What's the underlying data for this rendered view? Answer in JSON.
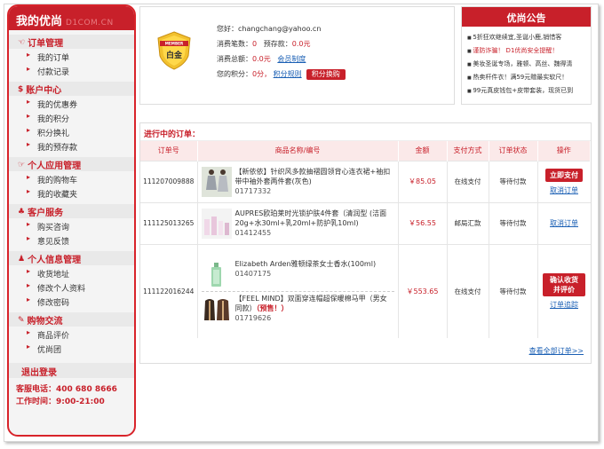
{
  "sidebar": {
    "title": "我的优尚",
    "title_ghost": "D1COM.CN",
    "sections": [
      {
        "icon": "clipboard-icon",
        "glyph": "☜",
        "label": "订单管理",
        "items": [
          "我的订单",
          "付款记录"
        ]
      },
      {
        "icon": "dollar-icon",
        "glyph": "$",
        "label": "账户中心",
        "items": [
          "我的优惠券",
          "我的积分",
          "积分换礼",
          "我的预存款"
        ]
      },
      {
        "icon": "app-icon",
        "glyph": "☞",
        "label": "个人应用管理",
        "items": [
          "我的购物车",
          "我的收藏夹"
        ]
      },
      {
        "icon": "service-icon",
        "glyph": "♣",
        "label": "客户服务",
        "items": [
          "购买咨询",
          "意见反馈"
        ]
      },
      {
        "icon": "user-icon",
        "glyph": "♟",
        "label": "个人信息管理",
        "items": [
          "收货地址",
          "修改个人资料",
          "修改密码"
        ]
      },
      {
        "icon": "chat-icon",
        "glyph": "✎",
        "label": "购物交流",
        "items": [
          "商品评价",
          "优尚团"
        ]
      }
    ],
    "logout": "退出登录",
    "phone": "客服电话：400 680 8666",
    "hours": "工作时间：9:00-21:00"
  },
  "user": {
    "badge_text": "白金",
    "badge_top": "MEMBER",
    "greeting": "您好：changchang@yahoo.cn",
    "spend_count_label": "消费笔数：",
    "spend_count": "0",
    "deposit_label": "预存款：",
    "deposit": "0.0元",
    "spend_total_label": "消费总额：",
    "spend_total": "0.0元",
    "member_rules": "会员制度",
    "points_label": "您的积分：",
    "points": "0分，",
    "points_rules": "积分规则",
    "exchange_button": "积分换购"
  },
  "notice": {
    "title": "优尚公告",
    "items": [
      {
        "text": "5折狂欢继续宜,圣诞小鹿,销惜客",
        "hot": false
      },
      {
        "text": "谨防诈骗！ D1优尚安全提醒！",
        "hot": true
      },
      {
        "text": "美妆圣诞专场，雅顿、高丝、魏得清",
        "hot": false
      },
      {
        "text": "热卖杆件衣！满59元赠最实软尺！",
        "hot": false
      },
      {
        "text": "99元真皮钱包+皮带套装，现货已到",
        "hot": false
      }
    ]
  },
  "orders": {
    "title": "进行中的订单：",
    "columns": [
      "订单号",
      "商品名称/编号",
      "金额",
      "支付方式",
      "订单状态",
      "操作"
    ],
    "rows": [
      {
        "id": "111207009888",
        "products": [
          {
            "thumb": "dress-thumb",
            "name": "【新依依】针织风多款抽褶圆领背心连衣裙+袖扣带中袖外套两件套(灰色)",
            "code": "01717332",
            "hl": ""
          }
        ],
        "amount": "￥85.05",
        "pay": "在线支付",
        "status": "等待付款",
        "action_button": "立即支付",
        "action_link": "取消订单"
      },
      {
        "id": "111125013265",
        "products": [
          {
            "thumb": "cosmetics-thumb",
            "name": "AUPRES欧珀莱时光锁护肤4件套（清润型 (洁面20g+水30ml+乳20ml+防护乳10ml)",
            "code": "01412455",
            "hl": ""
          }
        ],
        "amount": "￥56.55",
        "pay": "邮局汇款",
        "status": "等待付款",
        "action_button": "",
        "action_link": "取消订单"
      },
      {
        "id": "111122016244",
        "products": [
          {
            "thumb": "perfume-thumb",
            "name": "Elizabeth Arden雅顿绿茶女士香水(100ml)",
            "code": "01407175",
            "hl": ""
          },
          {
            "thumb": "jacket-thumb",
            "name": "【FEEL MIND】双面穿连帽超保暖棉马甲（男女同款）",
            "code": "01719626",
            "hl": "（预售！）"
          }
        ],
        "amount": "￥553.65",
        "pay": "在线支付",
        "status": "等待付款",
        "action_button": "确认收货并评价",
        "action_link": "订单追踪"
      }
    ],
    "view_all": "查看全部订单>>"
  },
  "colors": {
    "brand_red": "#c8202a",
    "link_blue": "#1a5fb4",
    "header_pink": "#fbe9e9"
  }
}
